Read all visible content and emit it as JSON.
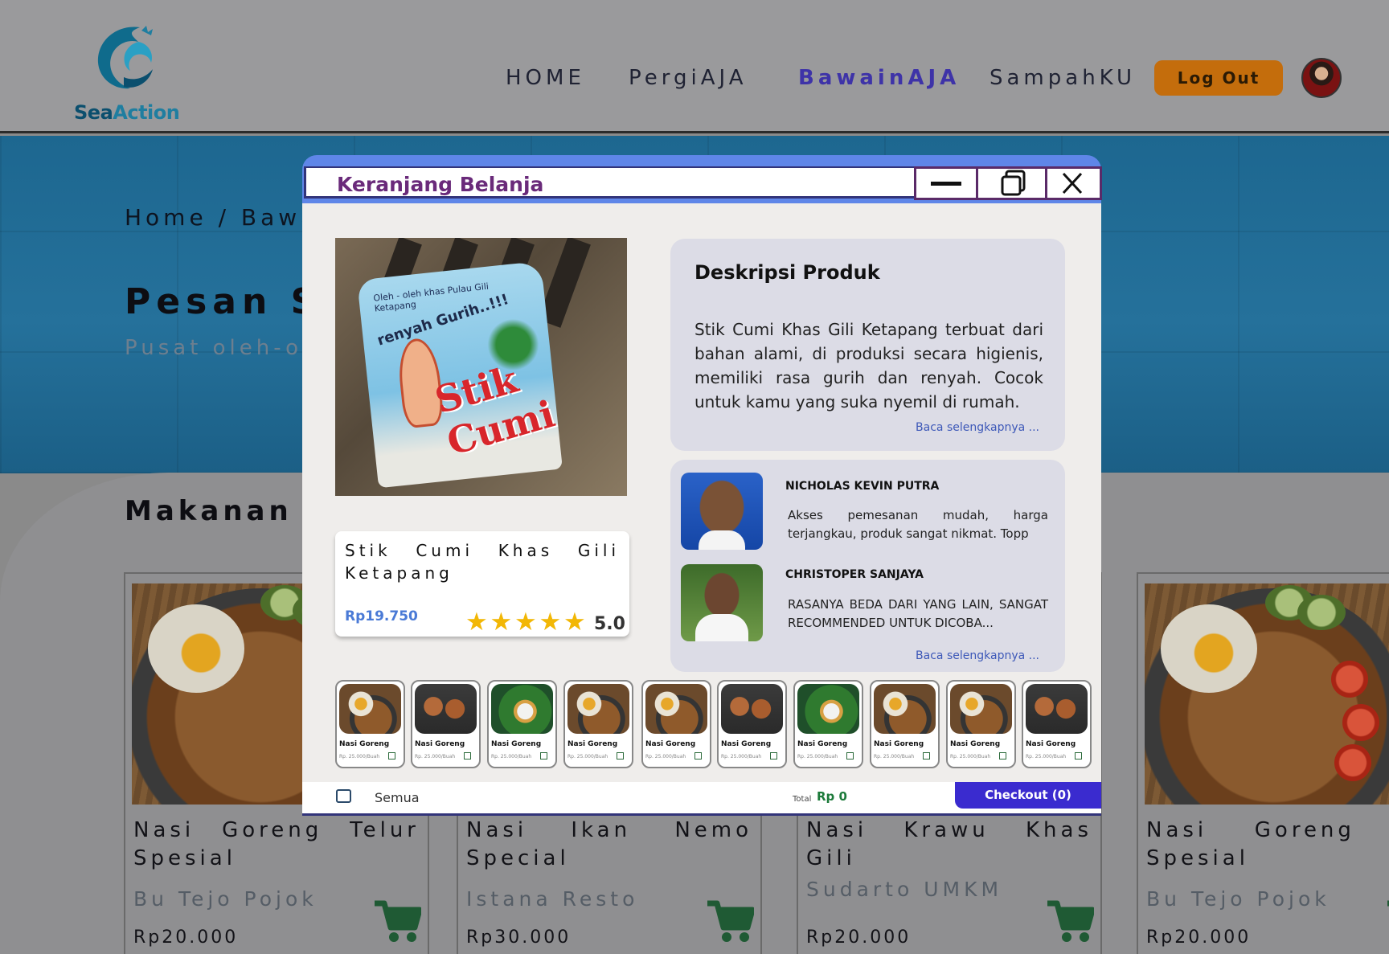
{
  "brand": {
    "logo_part1": "Sea",
    "logo_part2": "Action"
  },
  "nav": {
    "links": [
      {
        "label": "HOME",
        "active": false
      },
      {
        "label": "PergiAJA",
        "active": false
      },
      {
        "label": "BawainAJA",
        "active": true
      },
      {
        "label": "SampahKU",
        "active": false
      }
    ],
    "logout_label": "Log Out"
  },
  "hero": {
    "breadcrumb": "Home / Bawai",
    "title": "Pesan Se",
    "subtitle": "Pusat oleh-ole"
  },
  "section_title": "Makanan da",
  "food_cards": [
    {
      "name": "Nasi Goreng Telur Spesial",
      "vendor": "Bu Tejo Pojok",
      "price": "Rp20.000"
    },
    {
      "name": "Nasi Ikan Nemo Special",
      "vendor": "Istana Resto",
      "price": "Rp30.000"
    },
    {
      "name": "Nasi Krawu Khas Gili",
      "vendor": "Sudarto UMKM",
      "price": "Rp20.000"
    },
    {
      "name": "Nasi Goreng Te Spesial",
      "vendor": "Bu Tejo Pojok",
      "price": "Rp20.000"
    }
  ],
  "modal": {
    "title": "Keranjang Belanja",
    "photo_text": {
      "brand_line": "Oleh - oleh khas Pulau Gili Ketapang",
      "tagline": "renyah Gurih..!!!",
      "product": "Stik Cumi"
    },
    "product": {
      "name": "Stik Cumi Khas Gili Ketapang",
      "price": "Rp19.750",
      "rating": "5.0",
      "stars": 5
    },
    "description": {
      "title": "Deskripsi Produk",
      "text": "Stik Cumi Khas Gili Ketapang terbuat dari bahan alami, di produksi secara higienis, memiliki rasa gurih dan renyah. Cocok untuk kamu yang suka nyemil di rumah.",
      "read_more": "Baca selengkapnya ..."
    },
    "reviews": {
      "items": [
        {
          "name": "NICHOLAS KEVIN PUTRA",
          "text": "Akses pemesanan mudah, harga terjangkau, produk sangat nikmat. Topp"
        },
        {
          "name": "CHRISTOPER SANJAYA",
          "text": "RASANYA BEDA DARI YANG LAIN, SANGAT RECOMMENDED UNTUK DICOBA..."
        }
      ],
      "read_more": "Baca selengkapnya ..."
    },
    "cart_items": [
      {
        "name": "Nasi Goreng",
        "price": "Rp. 25.000/Buah"
      },
      {
        "name": "Nasi Goreng",
        "price": "Rp. 25.000/Buah"
      },
      {
        "name": "Nasi Goreng",
        "price": "Rp. 25.000/Buah"
      },
      {
        "name": "Nasi Goreng",
        "price": "Rp. 25.000/Buah"
      },
      {
        "name": "Nasi Goreng",
        "price": "Rp. 25.000/Buah"
      },
      {
        "name": "Nasi Goreng",
        "price": "Rp. 25.000/Buah"
      },
      {
        "name": "Nasi Goreng",
        "price": "Rp. 25.000/Buah"
      },
      {
        "name": "Nasi Goreng",
        "price": "Rp. 25.000/Buah"
      },
      {
        "name": "Nasi Goreng",
        "price": "Rp. 25.000/Buah"
      },
      {
        "name": "Nasi Goreng",
        "price": "Rp. 25.000/Buah"
      }
    ],
    "footer": {
      "select_all_label": "Semua",
      "total_label": "Total",
      "total_value": "Rp 0",
      "checkout_label": "Checkout (0)"
    }
  },
  "colors": {
    "accent": "#3a2bcf",
    "nav_active": "#3e33a8",
    "logout": "#c46d0c",
    "price_blue": "#4a7ad6",
    "total_green": "#1c7a3a",
    "star": "#f2b705"
  }
}
